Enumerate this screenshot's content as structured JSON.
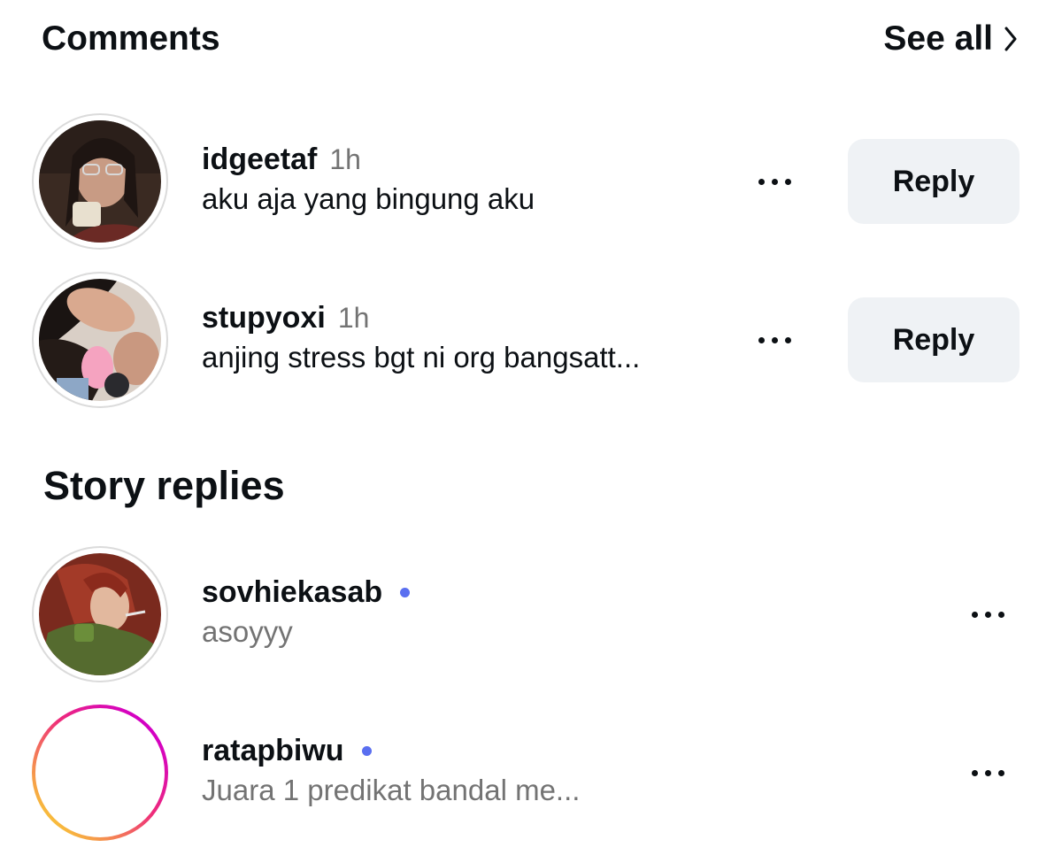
{
  "comments": {
    "title": "Comments",
    "see_all_label": "See all",
    "items": [
      {
        "username": "idgeetaf",
        "time": "1h",
        "text": "aku aja yang bingung aku",
        "reply_label": "Reply"
      },
      {
        "username": "stupyoxi",
        "time": "1h",
        "text": "anjing stress bgt ni org bangsatt...",
        "reply_label": "Reply"
      }
    ]
  },
  "story_replies": {
    "title": "Story replies",
    "items": [
      {
        "username": "sovhiekasab",
        "text": "asoyyy",
        "unread": true
      },
      {
        "username": "ratapbiwu",
        "text": "Juara 1 predikat bandal me...",
        "unread": true,
        "has_story_ring": true
      }
    ]
  },
  "colors": {
    "unread_dot": "#5a6ff0",
    "reply_button_bg": "#eff2f5",
    "muted_text": "#737373",
    "story_ring_gradient": [
      "#f9ce34",
      "#ee2a7b",
      "#d300c5"
    ]
  },
  "icons": {
    "see_all": "chevron-right-icon",
    "more": "more-horizontal-icon"
  }
}
